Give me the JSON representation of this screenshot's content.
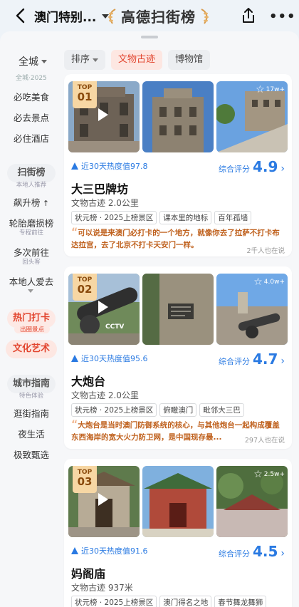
{
  "header": {
    "title": "澳门特别...",
    "brand": "高德扫街榜",
    "colors": {
      "accent": "#2a7ae2",
      "hot": "#e2452e"
    }
  },
  "sidebar": {
    "city": "全城",
    "top_caption": "全城·2025",
    "items_top": [
      "必吃美食",
      "必去景点",
      "必住酒店"
    ],
    "group1": {
      "title": "扫街榜",
      "sub": "本地人推荐"
    },
    "items_mid": [
      "飙升榜",
      "轮胎磨损榜",
      "多次前往",
      "本地人爱去"
    ],
    "item_subs": {
      "tire": "专程前往",
      "return": "回头客"
    },
    "group2": {
      "title": "热门打卡",
      "sub": "出圈景点"
    },
    "active": "文化艺术",
    "group3": {
      "title": "城市指南",
      "sub": "特色体验"
    },
    "items_bottom": [
      "逛街指南",
      "夜生活",
      "极致甄选"
    ]
  },
  "chips": {
    "sort": "排序",
    "culture": "文物古迹",
    "museum": "博物馆"
  },
  "cards": [
    {
      "rank_top": "TOP",
      "rank": "01",
      "heat": "近30天热度值97.8",
      "score_label": "综合评分",
      "score": "4.9",
      "name": "大三巴牌坊",
      "meta": "文物古迹  2.0公里",
      "tags": [
        "状元榜 · 2025上榜景区",
        "课本里的地标",
        "百年孤墙"
      ],
      "quote": "可以说是来澳门必打卡的一个地方，就像你去了拉萨不打卡布达拉宫，去了北京不打卡天安门一样。",
      "said": "2千人也在说",
      "fav": "17w+"
    },
    {
      "rank_top": "TOP",
      "rank": "02",
      "heat": "近30天热度值95.6",
      "score_label": "综合评分",
      "score": "4.7",
      "name": "大炮台",
      "meta": "文物古迹  2.0公里",
      "tags": [
        "状元榜 · 2025上榜景区",
        "俯瞰澳门",
        "毗邻大三巴"
      ],
      "quote": "大炮台是当时澳门防御系统的核心，与其他炮台一起构成覆盖东西海岸的宽大火力防卫网，是中国现存最...",
      "said": "297人也在说",
      "fav": "4.0w+",
      "cctv": "CCTV"
    },
    {
      "rank_top": "TOP",
      "rank": "03",
      "heat": "近30天热度值91.6",
      "score_label": "综合评分",
      "score": "4.5",
      "name": "妈阁庙",
      "meta": "文物古迹  937米",
      "tags": [
        "状元榜 · 2025上榜景区",
        "澳门得名之地",
        "春节舞龙舞狮"
      ],
      "fav": "2.5w+"
    }
  ]
}
